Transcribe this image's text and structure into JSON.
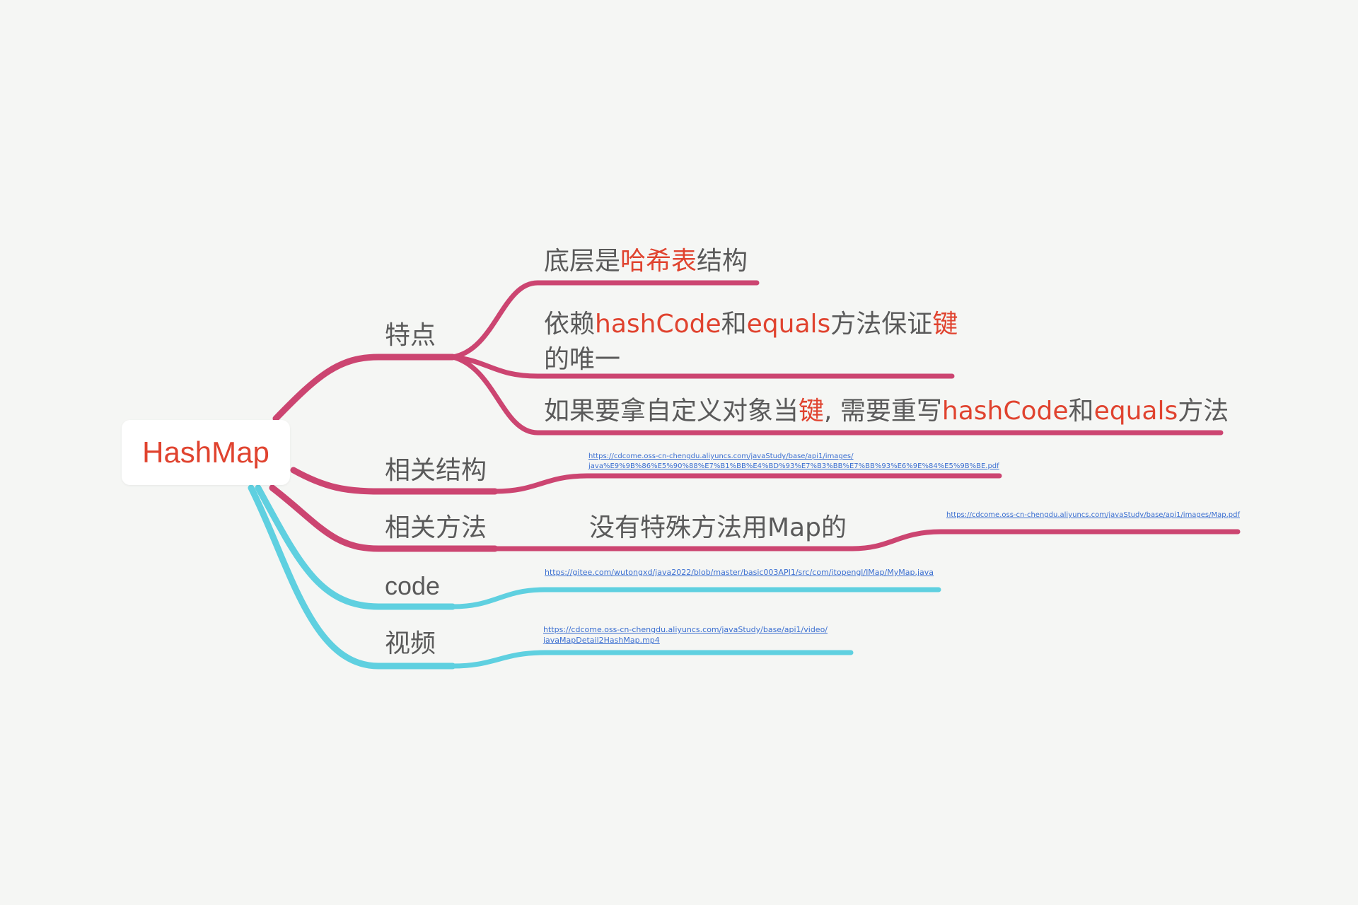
{
  "mindmap": {
    "root": {
      "label": "HashMap"
    },
    "branches": {
      "features": {
        "label": "特点",
        "children": {
          "c1": [
            "底层是",
            "哈希表",
            "结构"
          ],
          "c2_line1": [
            "依赖",
            "hashCode",
            "和",
            "equals",
            "方法保证",
            "键"
          ],
          "c2_line2": "的唯一",
          "c3": [
            "如果要拿自定义对象当",
            "键",
            ", 需要重写",
            "hashCode",
            "和",
            "equals",
            "方法"
          ]
        }
      },
      "structures": {
        "label": "相关结构",
        "link_line1": "https://cdcome.oss-cn-chengdu.aliyuncs.com/javaStudy/base/api1/images/",
        "link_line2": "java%E9%9B%86%E5%90%88%E7%B1%BB%E4%BD%93%E7%B3%BB%E7%BB%93%E6%9E%84%E5%9B%BE.pdf"
      },
      "methods": {
        "label": "相关方法",
        "note": "没有特殊方法用Map的",
        "link": "https://cdcome.oss-cn-chengdu.aliyuncs.com/javaStudy/base/api1/images/Map.pdf"
      },
      "code": {
        "label": "code",
        "link": "https://gitee.com/wutongxd/java2022/blob/master/basic003API1/src/com/itopengl/IMap/MyMap.java"
      },
      "video": {
        "label": "视频",
        "link_line1": "https://cdcome.oss-cn-chengdu.aliyuncs.com/javaStudy/base/api1/video/",
        "link_line2": "javaMapDetail2HashMap.mp4"
      }
    },
    "colors": {
      "background": "#f5f6f4",
      "branch_pink": "#cc4571",
      "branch_cyan": "#5fd0e0",
      "highlight": "#e0432f",
      "text": "#5a5a5a",
      "link": "#3b6fd1"
    }
  }
}
